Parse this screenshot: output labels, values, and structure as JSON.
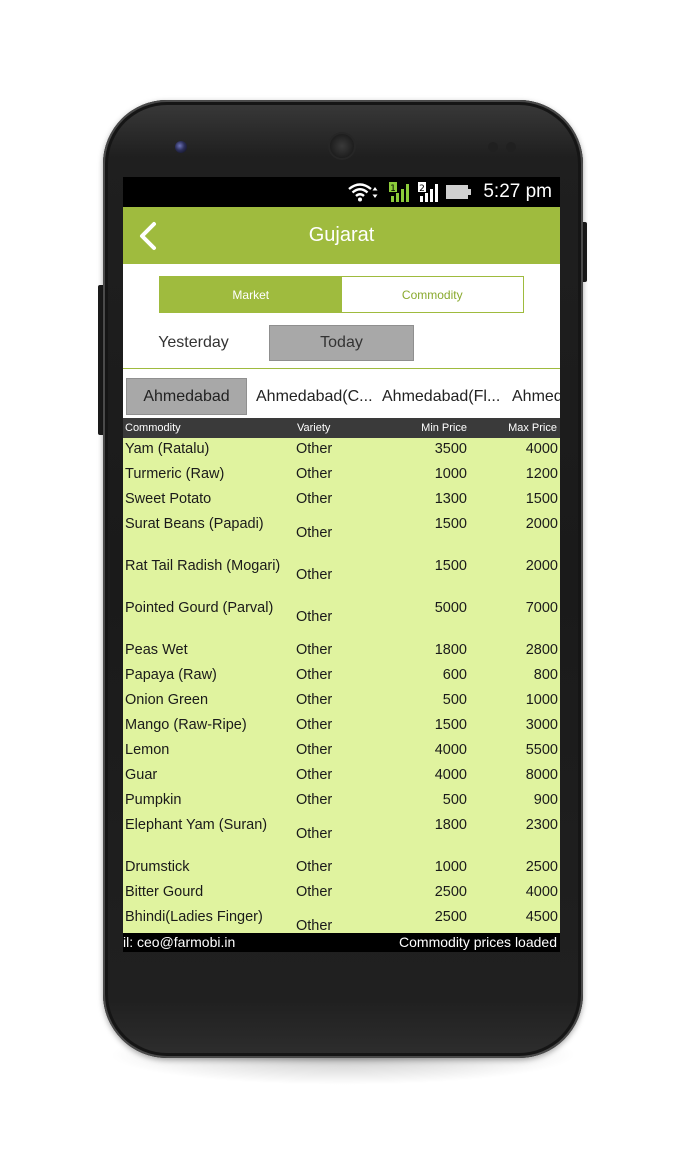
{
  "status_bar": {
    "time": "5:27 pm",
    "icons": [
      "wifi-icon",
      "signal-sim1-icon",
      "signal-sim2-icon",
      "battery-icon"
    ],
    "sim1_label": "1",
    "sim2_label": "2"
  },
  "app_bar": {
    "title": "Gujarat",
    "back_icon": "chevron-left-icon"
  },
  "segments": {
    "market": "Market",
    "commodity": "Commodity",
    "selected": "Market"
  },
  "days": {
    "yesterday": "Yesterday",
    "today": "Today",
    "selected": "Today"
  },
  "markets": [
    {
      "label": "Ahmedabad",
      "selected": true
    },
    {
      "label": "Ahmedabad(C..."
    },
    {
      "label": "Ahmedabad(Fl..."
    },
    {
      "label": "Ahmed"
    }
  ],
  "table": {
    "headers": {
      "commodity": "Commodity",
      "variety": "Variety",
      "min_price": "Min Price",
      "max_price": "Max Price"
    },
    "rows": [
      {
        "name": "Yam (Ratalu)",
        "variety": "Other",
        "min": "3500",
        "max": "4000"
      },
      {
        "name": "Turmeric (Raw)",
        "variety": "Other",
        "min": "1000",
        "max": "1200"
      },
      {
        "name": "Sweet Potato",
        "variety": "Other",
        "min": "1300",
        "max": "1500"
      },
      {
        "name": "Surat Beans (Papadi)",
        "variety": "Other",
        "min": "1500",
        "max": "2000"
      },
      {
        "name": "Rat Tail Radish (Mogari)",
        "variety": "Other",
        "min": "1500",
        "max": "2000"
      },
      {
        "name": "Pointed Gourd (Parval)",
        "variety": "Other",
        "min": "5000",
        "max": "7000"
      },
      {
        "name": "Peas Wet",
        "variety": "Other",
        "min": "1800",
        "max": "2800"
      },
      {
        "name": "Papaya (Raw)",
        "variety": "Other",
        "min": "600",
        "max": "800"
      },
      {
        "name": "Onion Green",
        "variety": "Other",
        "min": "500",
        "max": "1000"
      },
      {
        "name": "Mango (Raw-Ripe)",
        "variety": "Other",
        "min": "1500",
        "max": "3000"
      },
      {
        "name": "Lemon",
        "variety": "Other",
        "min": "4000",
        "max": "5500"
      },
      {
        "name": "Guar",
        "variety": "Other",
        "min": "4000",
        "max": "8000"
      },
      {
        "name": "Pumpkin",
        "variety": "Other",
        "min": "500",
        "max": "900"
      },
      {
        "name": "Elephant Yam (Suran)",
        "variety": "Other",
        "min": "1800",
        "max": "2300"
      },
      {
        "name": "Drumstick",
        "variety": "Other",
        "min": "1000",
        "max": "2500"
      },
      {
        "name": "Bitter Gourd",
        "variety": "Other",
        "min": "2500",
        "max": "4000"
      },
      {
        "name": "Bhindi(Ladies Finger)",
        "variety": "Other",
        "min": "2500",
        "max": "4500"
      }
    ]
  },
  "ticker": {
    "left_text": "il: ceo@farmobi.in",
    "right_text": "Commodity prices loaded"
  },
  "colors": {
    "accent": "#9fbb3e",
    "table_bg": "#e0f39f",
    "header_bg": "#3a3a3a",
    "selected_tab": "#a8a8a8"
  }
}
